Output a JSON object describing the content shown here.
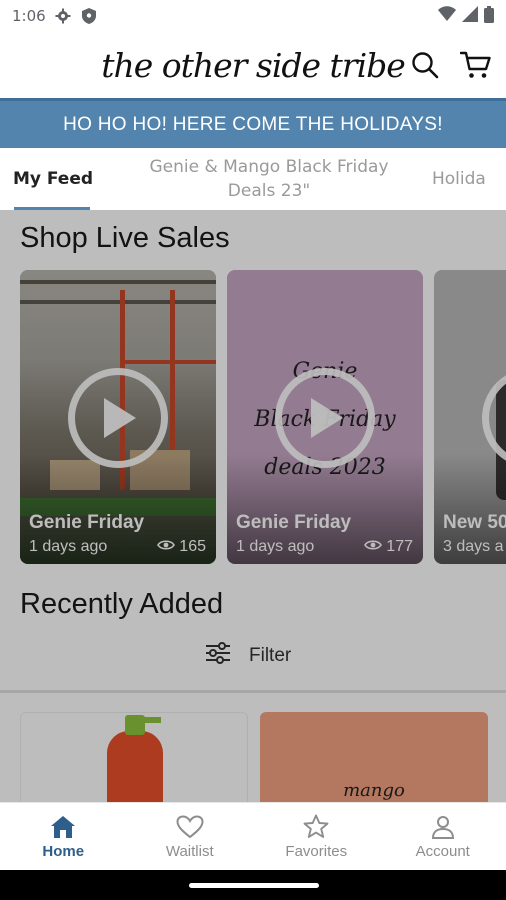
{
  "status_bar": {
    "time": "1:06",
    "left_icons": [
      "gear-icon",
      "shield-icon"
    ],
    "right_icons": [
      "wifi-icon",
      "signal-icon",
      "battery-icon"
    ]
  },
  "header": {
    "logo_text": "the other side tribe",
    "icons": [
      "search-icon",
      "cart-icon"
    ]
  },
  "banner": {
    "text": "HO HO HO! HERE COME THE HOLIDAYS!"
  },
  "tabs": [
    {
      "label": "My Feed",
      "active": true
    },
    {
      "label": "Genie & Mango Black Friday Deals  23\"",
      "active": false
    },
    {
      "label": "Holida",
      "active": false
    }
  ],
  "shop_live_sales": {
    "title": "Shop Live Sales",
    "cards": [
      {
        "title": "Genie Friday",
        "ago": "1 days ago",
        "views": "165"
      },
      {
        "title": "Genie Friday",
        "ago": "1 days ago",
        "views": "177",
        "image_text": [
          "Genie",
          "Black Friday",
          "deals 2023"
        ]
      },
      {
        "title": "New 50",
        "ago": "3 days a",
        "views": ""
      }
    ]
  },
  "recently_added": {
    "title": "Recently Added",
    "filter_label": "Filter",
    "products": [
      {
        "image_text": ""
      },
      {
        "image_text": "mango"
      }
    ]
  },
  "bottom_nav": [
    {
      "label": "Home",
      "icon": "home-icon",
      "active": true
    },
    {
      "label": "Waitlist",
      "icon": "heart-icon",
      "active": false
    },
    {
      "label": "Favorites",
      "icon": "star-icon",
      "active": false
    },
    {
      "label": "Account",
      "icon": "account-icon",
      "active": false
    }
  ],
  "colors": {
    "banner": "#5384ad",
    "accent": "#2d5e8c",
    "overlay": "rgba(0,0,0,0.26)"
  }
}
